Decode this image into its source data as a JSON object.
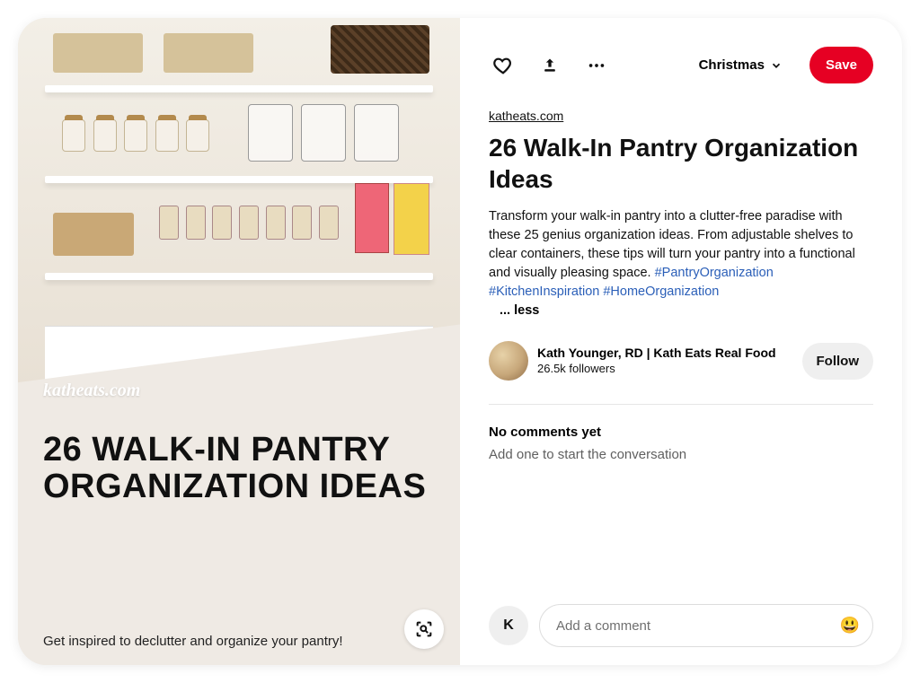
{
  "pin_image": {
    "brand_watermark": "katheats.com",
    "overlay_title": "26 WALK-IN PANTRY ORGANIZATION IDEAS",
    "overlay_tagline": "Get inspired to declutter and organize your pantry!"
  },
  "actions": {
    "board_selector_label": "Christmas",
    "save_label": "Save"
  },
  "source_domain": "katheats.com",
  "pin_title": "26 Walk-In Pantry Organization Ideas",
  "pin_description_plain": "Transform your walk-in pantry into a clutter-free paradise with these 25 genius organization ideas. From adjustable shelves to clear containers, these tips will turn your pantry into a functional and visually pleasing space.",
  "pin_hashtags": [
    "#PantryOrganization",
    "#KitchenInspiration",
    "#HomeOrganization"
  ],
  "less_toggle_label": "... less",
  "author": {
    "name": "Kath Younger, RD | Kath Eats Real Food",
    "followers_label": "26.5k followers",
    "follow_button_label": "Follow"
  },
  "comments": {
    "heading": "No comments yet",
    "empty_prompt": "Add one to start the conversation",
    "input_placeholder": "Add a comment",
    "current_user_initial": "K"
  }
}
